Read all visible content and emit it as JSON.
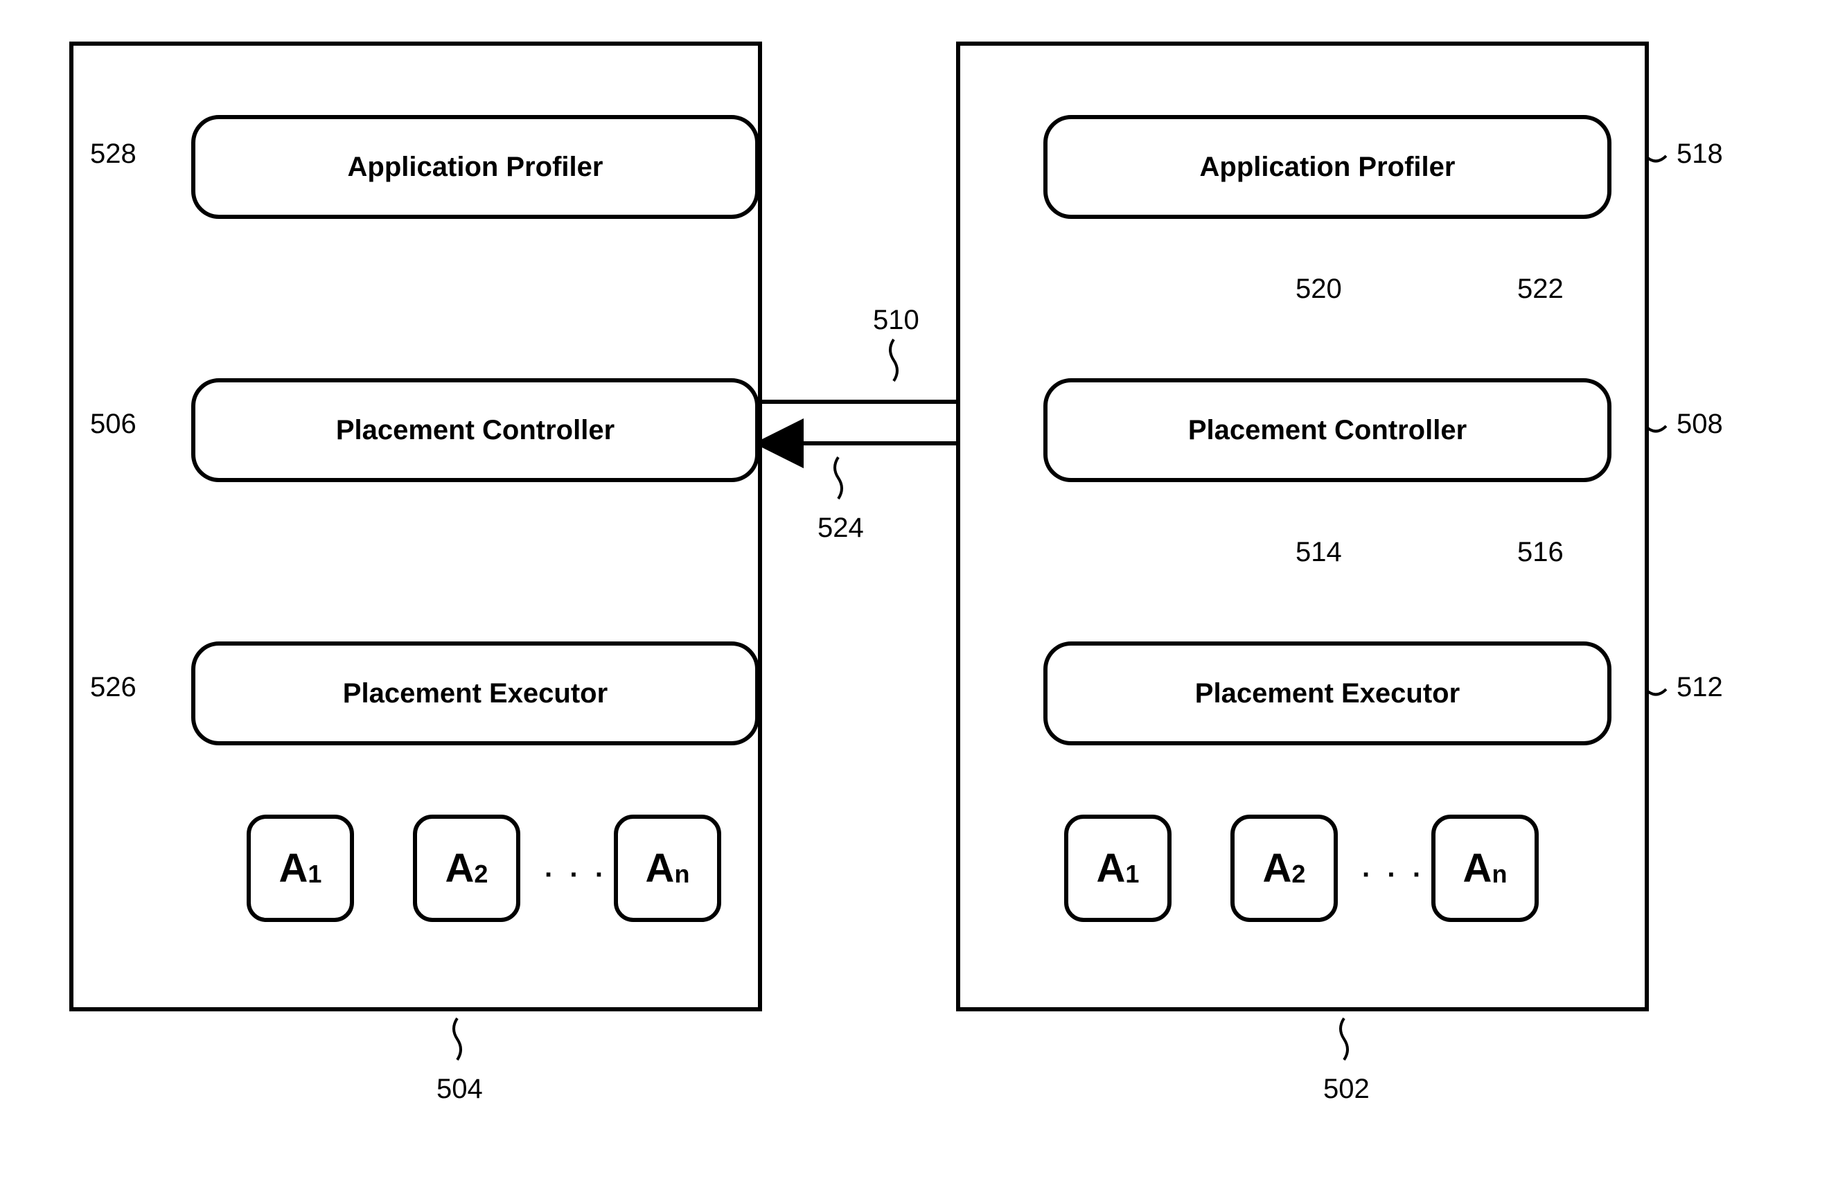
{
  "left_node": {
    "ref": "504",
    "profiler": {
      "label": "Application Profiler",
      "ref": "528"
    },
    "controller": {
      "label": "Placement Controller",
      "ref": "506"
    },
    "executor": {
      "label": "Placement Executor",
      "ref": "526"
    },
    "apps": {
      "a1": "A",
      "a1sub": "1",
      "a2": "A",
      "a2sub": "2",
      "an": "A",
      "ansub": "n",
      "dots": "· · ·"
    }
  },
  "right_node": {
    "ref": "502",
    "profiler": {
      "label": "Application Profiler",
      "ref": "518"
    },
    "controller": {
      "label": "Placement Controller",
      "ref": "508"
    },
    "executor": {
      "label": "Placement Executor",
      "ref": "512"
    },
    "apps": {
      "a1": "A",
      "a1sub": "1",
      "a2": "A",
      "a2sub": "2",
      "an": "A",
      "ansub": "n",
      "dots": "· · ·"
    }
  },
  "arrows": {
    "top_to_right": "510",
    "bottom_to_left": "524",
    "ctrl_to_exec_down": "514",
    "exec_to_ctrl_up": "516",
    "profiler_to_ctrl_down": "522",
    "ctrl_to_profiler_up": "520"
  }
}
